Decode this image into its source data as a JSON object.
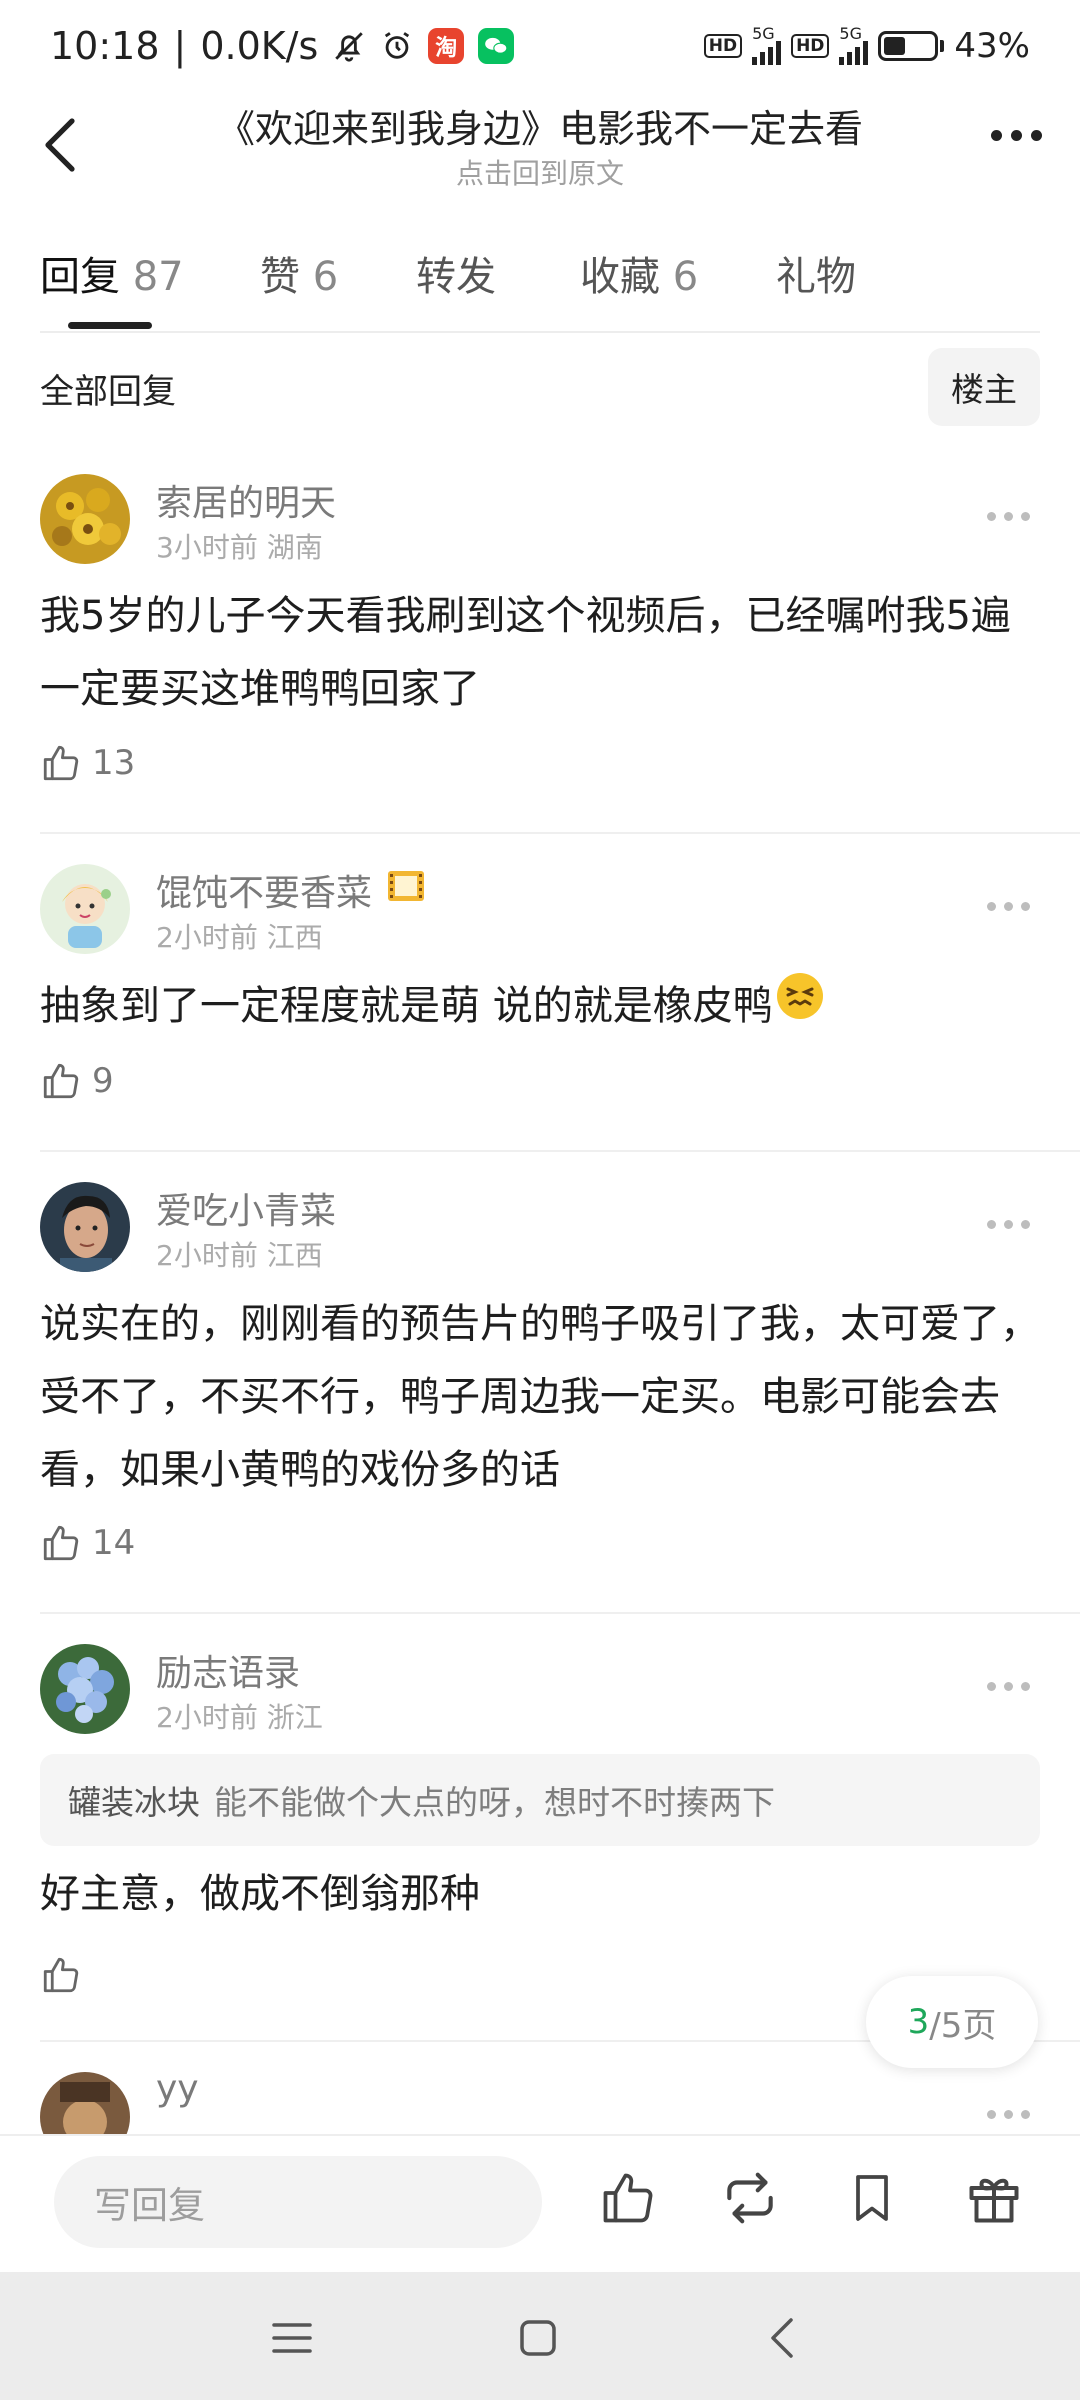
{
  "status_bar": {
    "time": "10:18",
    "speed": "0.0K/s",
    "taobao_label": "淘",
    "hd1": "HD",
    "net1": "5G",
    "hd2": "HD",
    "net2": "5G",
    "battery_percent": 43,
    "battery_text": "43%"
  },
  "header": {
    "title": "《欢迎来到我身边》电影我不一定去看",
    "subtitle": "点击回到原文"
  },
  "tabs": [
    {
      "label": "回复",
      "count": "87"
    },
    {
      "label": "赞",
      "count": "6"
    },
    {
      "label": "转发",
      "count": ""
    },
    {
      "label": "收藏",
      "count": "6"
    },
    {
      "label": "礼物",
      "count": ""
    }
  ],
  "filter": {
    "all_label": "全部回复",
    "owner_label": "楼主"
  },
  "comments": [
    {
      "username": "索居的明天",
      "meta": "3小时前 湖南",
      "text": "我5岁的儿子今天看我刷到这个视频后，已经嘱咐我5遍一定要买这堆鸭鸭回家了",
      "likes": "13"
    },
    {
      "username": "馄饨不要香菜",
      "meta": "2小时前 江西",
      "text": "抽象到了一定程度就是萌 说的就是橡皮鸭",
      "likes": "9"
    },
    {
      "username": "爱吃小青菜",
      "meta": "2小时前 江西",
      "text": "说实在的，刚刚看的预告片的鸭子吸引了我，太可爱了，受不了，不买不行，鸭子周边我一定买。电影可能会去看，如果小黄鸭的戏份多的话",
      "likes": "14"
    },
    {
      "username": "励志语录",
      "meta": "2小时前 浙江",
      "quote_author": "罐装冰块",
      "quote_text": "能不能做个大点的呀，想时不时揍两下",
      "text": "好主意，做成不倒翁那种",
      "likes": ""
    },
    {
      "username": "yy"
    }
  ],
  "pager": {
    "current": "3",
    "total": "/5页"
  },
  "bottom_bar": {
    "reply_placeholder": "写回复"
  },
  "colors": {
    "accent_green": "#1ea75a",
    "wechat_green": "#07c160",
    "taobao_red": "#e8442e"
  },
  "icons": [
    "bell-off-icon",
    "alarm-icon",
    "taobao-icon",
    "wechat-icon",
    "back-arrow-icon",
    "more-icon",
    "thumb-up-icon",
    "repost-icon",
    "bookmark-icon",
    "gift-icon",
    "menu-icon",
    "home-icon",
    "back-nav-icon"
  ]
}
